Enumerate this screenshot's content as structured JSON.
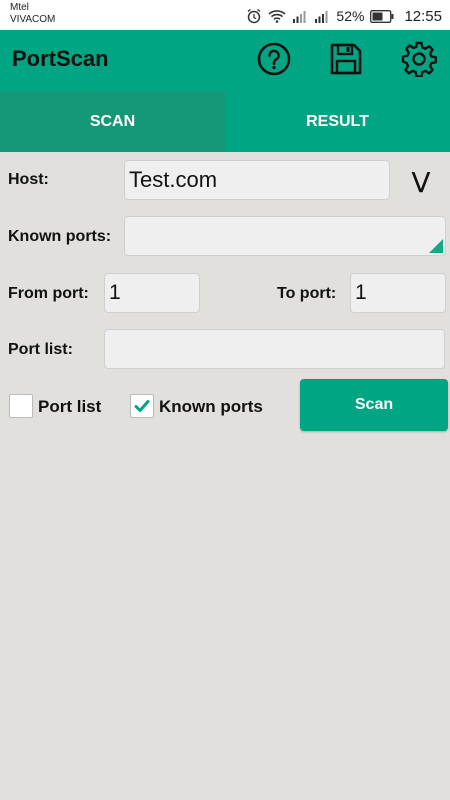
{
  "status_bar": {
    "carrier_1": "Mtel",
    "carrier_2": "VIVACOM",
    "battery_percent": "52%",
    "time": "12:55"
  },
  "app_bar": {
    "title": "PortScan",
    "icons": [
      "help-icon",
      "save-icon",
      "settings-icon"
    ]
  },
  "tabs": [
    {
      "label": "SCAN",
      "active": true
    },
    {
      "label": "RESULT",
      "active": false
    }
  ],
  "form": {
    "host_label": "Host:",
    "host_value": "Test.com",
    "dropdown_glyph": "V",
    "known_ports_label": "Known ports:",
    "known_ports_value": "",
    "from_port_label": "From port:",
    "from_port_value": "1",
    "to_port_label": "To port:",
    "to_port_value": "1",
    "port_list_label": "Port list:",
    "port_list_value": ""
  },
  "options": {
    "port_list_label": "Port list",
    "port_list_checked": false,
    "known_ports_label": "Known ports",
    "known_ports_checked": true
  },
  "scan_button_label": "Scan",
  "colors": {
    "accent": "#00a683",
    "tab_active": "#149878",
    "background": "#e1e0dc"
  }
}
